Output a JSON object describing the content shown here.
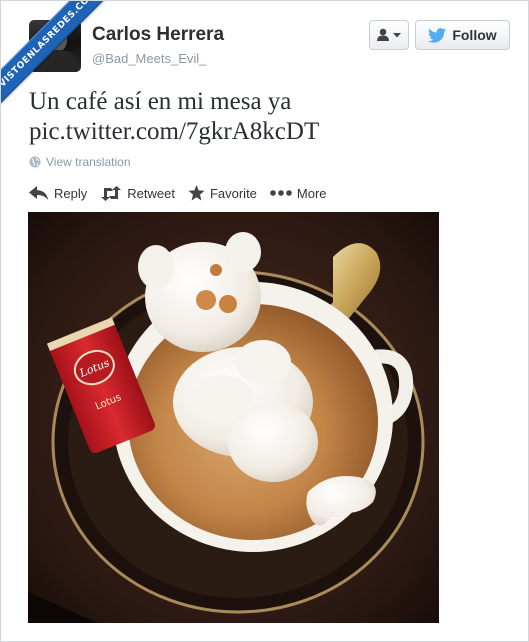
{
  "watermark": {
    "text": "VISTOENLASREDES.COM",
    "color": "#1f63b7"
  },
  "user": {
    "name": "Carlos Herrera",
    "handle": "@Bad_Meets_Evil_",
    "avatar_icon": "user-avatar"
  },
  "header": {
    "user_menu_icon": "user-silhouette-icon",
    "follow_label": "Follow",
    "follow_icon": "twitter-bird-icon"
  },
  "tweet": {
    "text_line1": "Un café así en mi mesa ya",
    "text_line2": "pic.twitter.com/7gkrA8kcDT",
    "translation_label": "View translation"
  },
  "actions": {
    "reply": "Reply",
    "retweet": "Retweet",
    "favorite": "Favorite",
    "more": "More"
  },
  "photo": {
    "cookie_brand": "Lotus",
    "cookie_text": "Lotus"
  },
  "colors": {
    "twitter_blue": "#55acee",
    "text": "#292f33",
    "muted": "#8899a6"
  }
}
